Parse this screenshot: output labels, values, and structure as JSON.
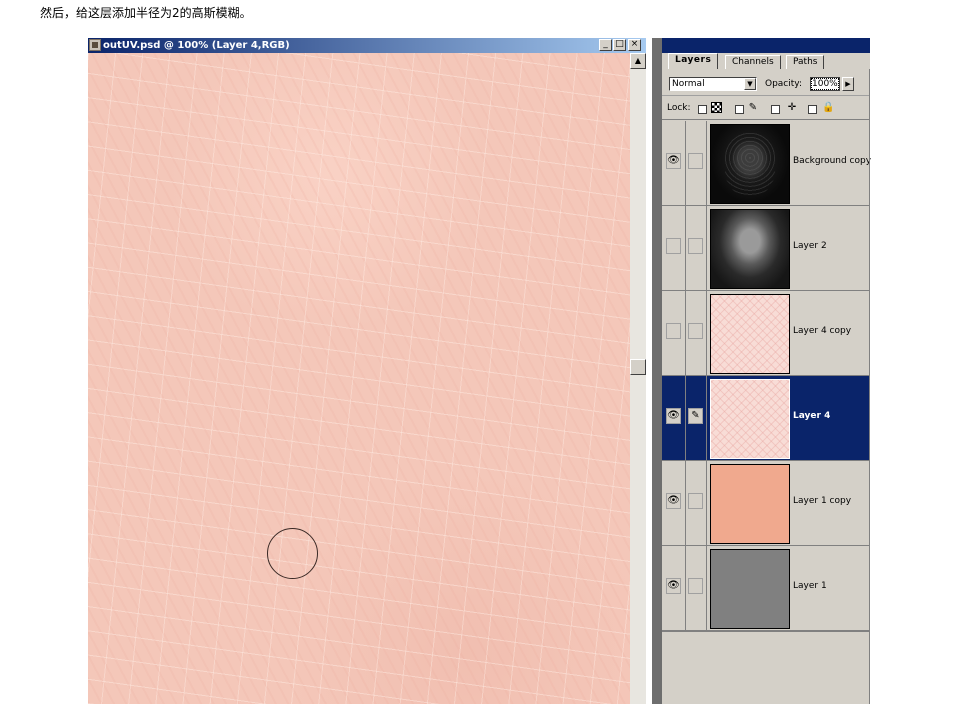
{
  "caption": "然后，给这层添加半径为2的高斯模糊。",
  "document": {
    "title": "outUV.psd @ 100% (Layer 4,RGB)",
    "minimize_glyph": "_",
    "maximize_glyph": "□",
    "close_glyph": "×",
    "scroll_up_glyph": "▲"
  },
  "panel": {
    "tabs": [
      {
        "label": "Layers",
        "active": true
      },
      {
        "label": "Channels",
        "active": false
      },
      {
        "label": "Paths",
        "active": false
      }
    ],
    "blend_mode": "Normal",
    "opacity_label": "Opacity:",
    "opacity_value": "100%",
    "lock_label": "Lock:",
    "layers": [
      {
        "name": "Background copy",
        "visible": true,
        "thumb": "dark-face-edges"
      },
      {
        "name": "Layer 2",
        "visible": false,
        "thumb": "face-render"
      },
      {
        "name": "Layer 4 copy",
        "visible": false,
        "thumb": "pink-pattern"
      },
      {
        "name": "Layer 4",
        "visible": true,
        "selected": true,
        "thumb": "pink-pattern"
      },
      {
        "name": "Layer 1 copy",
        "visible": true,
        "thumb": "salmon-fill"
      },
      {
        "name": "Layer 1",
        "visible": true,
        "thumb": "gray-fill"
      }
    ],
    "eye_glyph": "👁",
    "brush_glyph": "✎",
    "dropdown_glyph": "▼",
    "arrow_right_glyph": "▶",
    "move_glyph": "✛",
    "lock_glyph": "🔒"
  },
  "colors": {
    "selection": "#0a246a",
    "skin": "#f4c7b9",
    "salmon": "#f0a98e",
    "gray": "#808080"
  }
}
